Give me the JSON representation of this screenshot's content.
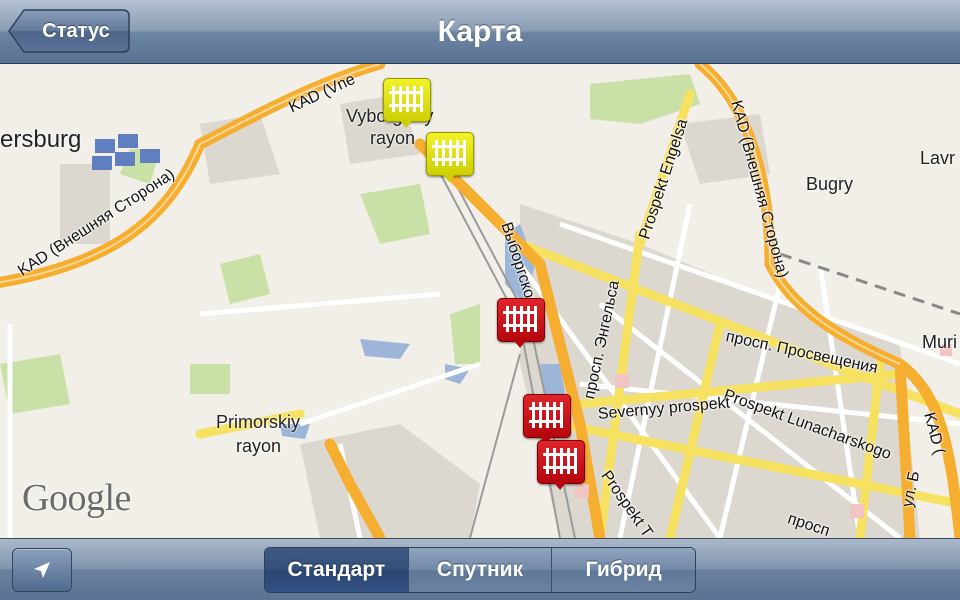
{
  "navbar": {
    "title": "Карта",
    "back_label": "Статус"
  },
  "map": {
    "places": [
      {
        "name": "ersburg"
      },
      {
        "name": "Vyborgskiy"
      },
      {
        "name": "rayon"
      },
      {
        "name": "Bugry"
      },
      {
        "name": "Lavr"
      },
      {
        "name": "Muri"
      },
      {
        "name": "Primorskiy"
      },
      {
        "name": "rayon"
      }
    ],
    "roads": [
      "KAD (Vne",
      "KAD (Внешняя Сторона)",
      "KAD (Внешняя Сторона)",
      "Выборгское ш.",
      "Prospekt Engelsa",
      "просп. Энгельса",
      "просп. Просвещения",
      "Prospekt Lunacharskogo",
      "Severnyy prospekt",
      "Prospekt T",
      "KAD (",
      "просп",
      "ул. Б"
    ],
    "watermark": "Google",
    "markers": [
      {
        "color": "yellow",
        "icon": "railway-crossing-icon"
      },
      {
        "color": "yellow",
        "icon": "railway-crossing-icon"
      },
      {
        "color": "red",
        "icon": "railway-crossing-icon"
      },
      {
        "color": "red",
        "icon": "railway-crossing-icon"
      },
      {
        "color": "red",
        "icon": "railway-crossing-icon"
      }
    ]
  },
  "toolbar": {
    "locate_icon": "location-arrow-icon",
    "segments": [
      {
        "label": "Стандарт",
        "selected": true
      },
      {
        "label": "Спутник",
        "selected": false
      },
      {
        "label": "Гибрид",
        "selected": false
      }
    ]
  },
  "colors": {
    "highway": "#f5b433",
    "major_road": "#fbe36c",
    "park": "#c8dfa5",
    "water": "#9fb7d8",
    "marker_red": "#d0161c",
    "marker_yellow": "#e8e818",
    "selected_segment": "#2f4a75"
  }
}
